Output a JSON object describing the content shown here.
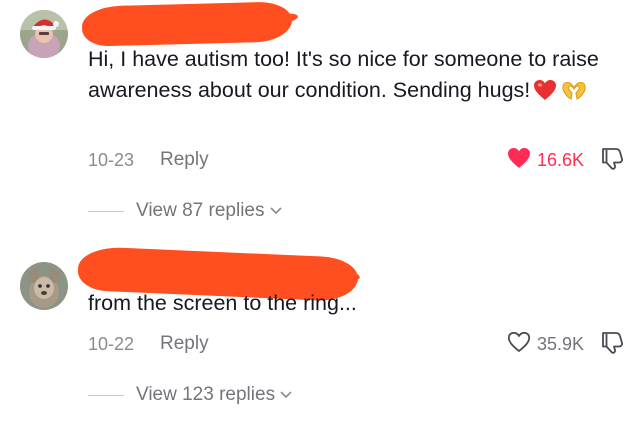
{
  "comments": [
    {
      "text": "Hi, I have autism too! It's so nice for someone to raise awareness about our condition. Sending hugs!",
      "emojis": [
        "heart-emoji",
        "heart-hands-emoji"
      ],
      "date": "10-23",
      "reply_label": "Reply",
      "likes": "16.6K",
      "liked": true,
      "view_replies": "View 87 replies"
    },
    {
      "text": "from the screen to the ring...",
      "date": "10-22",
      "reply_label": "Reply",
      "likes": "35.9K",
      "liked": false,
      "view_replies": "View 123 replies"
    }
  ],
  "colors": {
    "liked": "#fe2c55",
    "muted": "#74757b",
    "redaction": "#ff4e1f",
    "text": "#161823"
  },
  "icons": [
    "heart-filled-icon",
    "heart-outline-icon",
    "thumbs-down-icon",
    "chevron-down-icon"
  ]
}
